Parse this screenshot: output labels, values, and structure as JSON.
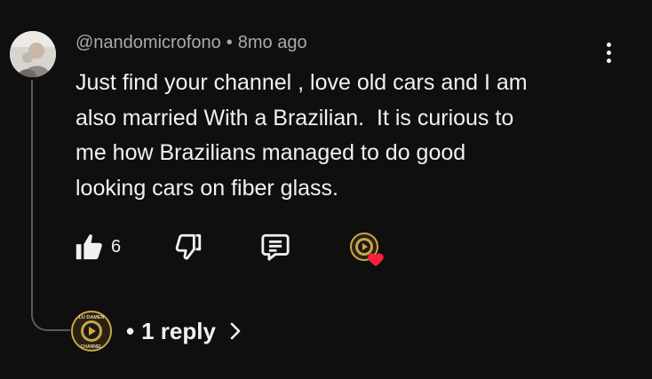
{
  "comment": {
    "author": "@nandomicrofono",
    "separator": "•",
    "time": "8mo ago",
    "text": "Just find your channel , love old cars and I am\nalso married With a Brazilian.  It is curious to\nme how Brazilians managed to do good\nlooking cars on fiber glass."
  },
  "actions": {
    "like_count": "6",
    "like_icon": "thumbs-up-icon",
    "dislike_icon": "thumbs-down-icon",
    "reply_icon": "reply-comment-icon",
    "creator_heart_icon": "creator-heart-icon"
  },
  "replies": {
    "dot": "•",
    "label": "1 reply",
    "channel_logo_text_top": "LU DAMEN",
    "channel_logo_text_bottom": "CHANNEL"
  },
  "colors": {
    "background": "#0f0f0f",
    "text": "#f1f1f1",
    "muted": "#aaaaaa",
    "thread_line": "#5a5a5a",
    "heart": "#ff1f3a",
    "logo_gold": "#c9a44a"
  }
}
